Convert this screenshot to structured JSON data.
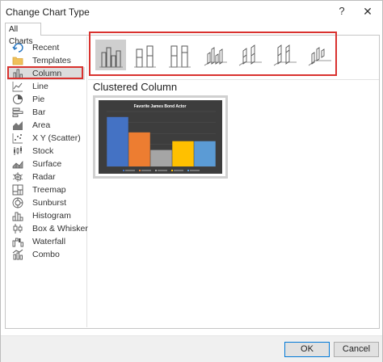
{
  "dialog": {
    "title": "Change Chart Type",
    "help_label": "?",
    "close_label": "✕"
  },
  "tab": {
    "label": "All Charts"
  },
  "sidebar": {
    "items": [
      {
        "label": "Recent",
        "icon": "recent-icon"
      },
      {
        "label": "Templates",
        "icon": "folder-icon"
      },
      {
        "label": "Column",
        "icon": "column-chart-icon",
        "selected": true
      },
      {
        "label": "Line",
        "icon": "line-chart-icon"
      },
      {
        "label": "Pie",
        "icon": "pie-chart-icon"
      },
      {
        "label": "Bar",
        "icon": "bar-chart-icon"
      },
      {
        "label": "Area",
        "icon": "area-chart-icon"
      },
      {
        "label": "X Y (Scatter)",
        "icon": "scatter-chart-icon"
      },
      {
        "label": "Stock",
        "icon": "stock-chart-icon"
      },
      {
        "label": "Surface",
        "icon": "surface-chart-icon"
      },
      {
        "label": "Radar",
        "icon": "radar-chart-icon"
      },
      {
        "label": "Treemap",
        "icon": "treemap-chart-icon"
      },
      {
        "label": "Sunburst",
        "icon": "sunburst-chart-icon"
      },
      {
        "label": "Histogram",
        "icon": "histogram-chart-icon"
      },
      {
        "label": "Box & Whisker",
        "icon": "box-whisker-chart-icon"
      },
      {
        "label": "Waterfall",
        "icon": "waterfall-chart-icon"
      },
      {
        "label": "Combo",
        "icon": "combo-chart-icon"
      }
    ]
  },
  "subtypes": [
    {
      "icon": "clustered-column-icon",
      "selected": true
    },
    {
      "icon": "stacked-column-icon"
    },
    {
      "icon": "100-stacked-column-icon"
    },
    {
      "icon": "3d-clustered-column-icon"
    },
    {
      "icon": "3d-stacked-column-icon"
    },
    {
      "icon": "3d-100-stacked-column-icon"
    },
    {
      "icon": "3d-column-icon"
    }
  ],
  "main": {
    "chart_name": "Clustered Column",
    "preview": {
      "title": "Favorite James Bond Actor",
      "bar_values": [
        45,
        31,
        15,
        23,
        23
      ],
      "bar_colors": [
        "#4472c4",
        "#ed7d31",
        "#a5a5a5",
        "#ffc000",
        "#5b9bd5"
      ],
      "y_max": 50
    }
  },
  "footer": {
    "ok_label": "OK",
    "cancel_label": "Cancel"
  },
  "colors": {
    "highlight": "#d9322f",
    "selected_bg": "#dcdcdc",
    "chart_bg": "#3d3d3d"
  }
}
